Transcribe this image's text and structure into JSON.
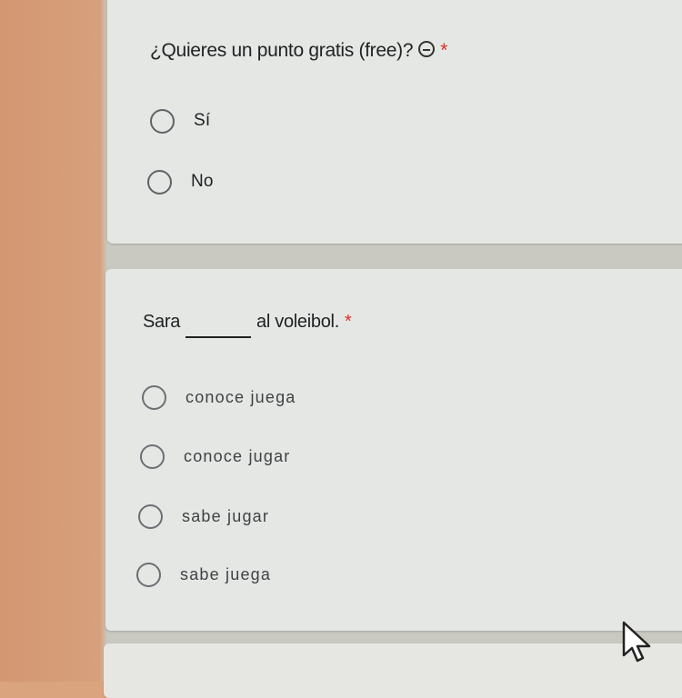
{
  "question1": {
    "text": "¿Quieres un punto gratis (free)?",
    "required": "*",
    "emoji": "emoji-icon",
    "options": [
      "Sí",
      "No"
    ]
  },
  "question2": {
    "text_before": "Sara",
    "text_after": "al voleibol.",
    "required": "*",
    "options": [
      "conoce juega",
      "conoce jugar",
      "sabe jugar",
      "sabe juega"
    ]
  },
  "colors": {
    "required": "#d93025",
    "card": "#e4e7e3",
    "radio_border": "#5f6368"
  }
}
